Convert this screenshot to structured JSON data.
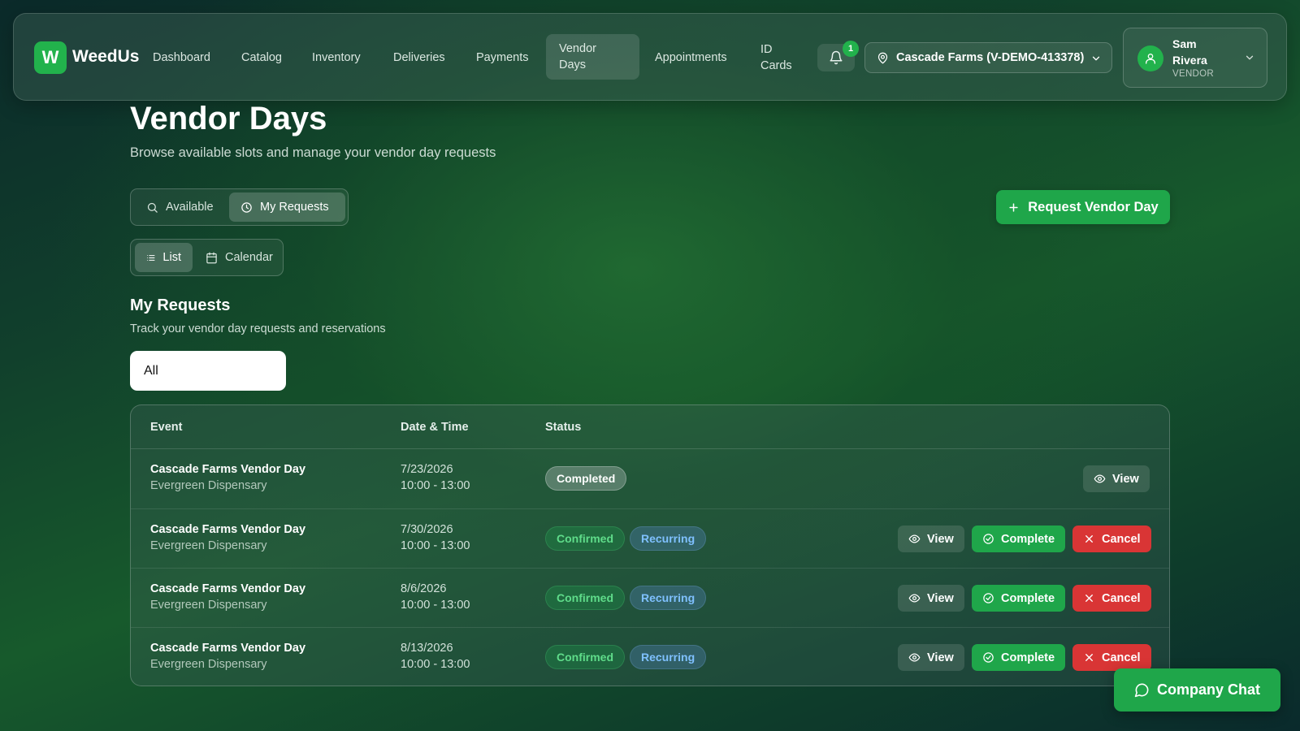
{
  "app": {
    "logo_letter": "W",
    "name": "WeedUs",
    "accent": "#1fa64a"
  },
  "nav": {
    "items": [
      {
        "label": "Dashboard"
      },
      {
        "label": "Catalog"
      },
      {
        "label": "Inventory"
      },
      {
        "label": "Deliveries"
      },
      {
        "label": "Payments"
      },
      {
        "label": "Vendor Days",
        "active": true
      },
      {
        "label": "Appointments"
      },
      {
        "label": "ID Cards"
      }
    ],
    "notification_count": "1",
    "location": "Cascade Farms (V-DEMO-413378)",
    "user": {
      "name": "Sam Rivera",
      "role": "VENDOR"
    }
  },
  "page": {
    "title": "Vendor Days",
    "subtitle": "Browse available slots and manage your vendor day requests"
  },
  "tabs": {
    "available": "Available",
    "my_requests": "My Requests",
    "active": "my_requests"
  },
  "views": {
    "list": "List",
    "calendar": "Calendar",
    "active": "list"
  },
  "request_button": "Request Vendor Day",
  "section": {
    "title": "My Requests",
    "subtitle": "Track your vendor day requests and reservations",
    "filter": "All"
  },
  "table": {
    "columns": [
      "Event",
      "Date & Time",
      "Status"
    ],
    "rows": [
      {
        "event": "Cascade Farms Vendor Day",
        "location": "Evergreen Dispensary",
        "date": "7/23/2026",
        "time": "10:00 - 13:00",
        "status": "Completed",
        "recurring": "",
        "actions": {
          "view": "View"
        }
      },
      {
        "event": "Cascade Farms Vendor Day",
        "location": "Evergreen Dispensary",
        "date": "7/30/2026",
        "time": "10:00 - 13:00",
        "status": "Confirmed",
        "recurring": "Recurring",
        "actions": {
          "view": "View",
          "complete": "Complete",
          "cancel": "Cancel"
        }
      },
      {
        "event": "Cascade Farms Vendor Day",
        "location": "Evergreen Dispensary",
        "date": "8/6/2026",
        "time": "10:00 - 13:00",
        "status": "Confirmed",
        "recurring": "Recurring",
        "actions": {
          "view": "View",
          "complete": "Complete",
          "cancel": "Cancel"
        }
      },
      {
        "event": "Cascade Farms Vendor Day",
        "location": "Evergreen Dispensary",
        "date": "8/13/2026",
        "time": "10:00 - 13:00",
        "status": "Confirmed",
        "recurring": "Recurring",
        "actions": {
          "view": "View",
          "complete": "Complete",
          "cancel": "Cancel"
        }
      }
    ]
  },
  "chat_button": "Company Chat"
}
